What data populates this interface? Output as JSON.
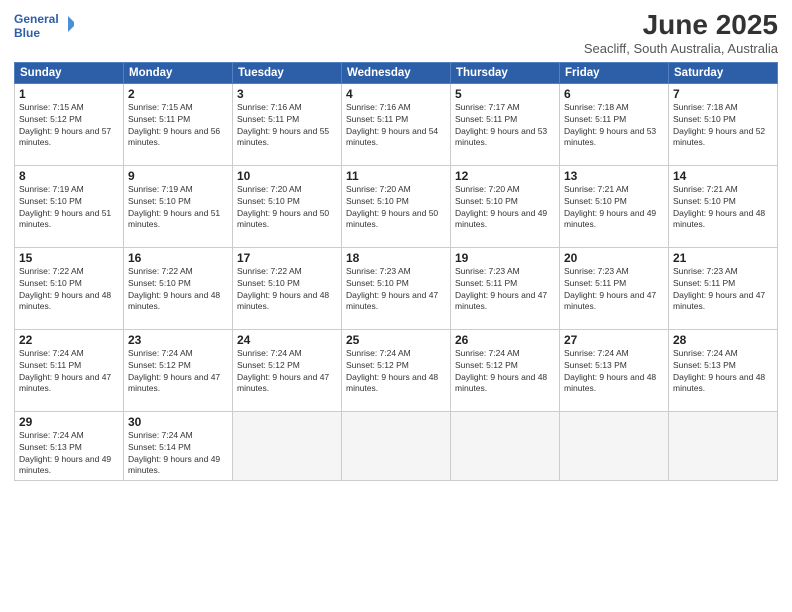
{
  "logo": {
    "line1": "General",
    "line2": "Blue"
  },
  "title": "June 2025",
  "subtitle": "Seacliff, South Australia, Australia",
  "weekdays": [
    "Sunday",
    "Monday",
    "Tuesday",
    "Wednesday",
    "Thursday",
    "Friday",
    "Saturday"
  ],
  "weeks": [
    [
      {
        "day": "1",
        "sunrise": "7:15 AM",
        "sunset": "5:12 PM",
        "daylight": "9 hours and 57 minutes."
      },
      {
        "day": "2",
        "sunrise": "7:15 AM",
        "sunset": "5:11 PM",
        "daylight": "9 hours and 56 minutes."
      },
      {
        "day": "3",
        "sunrise": "7:16 AM",
        "sunset": "5:11 PM",
        "daylight": "9 hours and 55 minutes."
      },
      {
        "day": "4",
        "sunrise": "7:16 AM",
        "sunset": "5:11 PM",
        "daylight": "9 hours and 54 minutes."
      },
      {
        "day": "5",
        "sunrise": "7:17 AM",
        "sunset": "5:11 PM",
        "daylight": "9 hours and 53 minutes."
      },
      {
        "day": "6",
        "sunrise": "7:18 AM",
        "sunset": "5:11 PM",
        "daylight": "9 hours and 53 minutes."
      },
      {
        "day": "7",
        "sunrise": "7:18 AM",
        "sunset": "5:10 PM",
        "daylight": "9 hours and 52 minutes."
      }
    ],
    [
      {
        "day": "8",
        "sunrise": "7:19 AM",
        "sunset": "5:10 PM",
        "daylight": "9 hours and 51 minutes."
      },
      {
        "day": "9",
        "sunrise": "7:19 AM",
        "sunset": "5:10 PM",
        "daylight": "9 hours and 51 minutes."
      },
      {
        "day": "10",
        "sunrise": "7:20 AM",
        "sunset": "5:10 PM",
        "daylight": "9 hours and 50 minutes."
      },
      {
        "day": "11",
        "sunrise": "7:20 AM",
        "sunset": "5:10 PM",
        "daylight": "9 hours and 50 minutes."
      },
      {
        "day": "12",
        "sunrise": "7:20 AM",
        "sunset": "5:10 PM",
        "daylight": "9 hours and 49 minutes."
      },
      {
        "day": "13",
        "sunrise": "7:21 AM",
        "sunset": "5:10 PM",
        "daylight": "9 hours and 49 minutes."
      },
      {
        "day": "14",
        "sunrise": "7:21 AM",
        "sunset": "5:10 PM",
        "daylight": "9 hours and 48 minutes."
      }
    ],
    [
      {
        "day": "15",
        "sunrise": "7:22 AM",
        "sunset": "5:10 PM",
        "daylight": "9 hours and 48 minutes."
      },
      {
        "day": "16",
        "sunrise": "7:22 AM",
        "sunset": "5:10 PM",
        "daylight": "9 hours and 48 minutes."
      },
      {
        "day": "17",
        "sunrise": "7:22 AM",
        "sunset": "5:10 PM",
        "daylight": "9 hours and 48 minutes."
      },
      {
        "day": "18",
        "sunrise": "7:23 AM",
        "sunset": "5:10 PM",
        "daylight": "9 hours and 47 minutes."
      },
      {
        "day": "19",
        "sunrise": "7:23 AM",
        "sunset": "5:11 PM",
        "daylight": "9 hours and 47 minutes."
      },
      {
        "day": "20",
        "sunrise": "7:23 AM",
        "sunset": "5:11 PM",
        "daylight": "9 hours and 47 minutes."
      },
      {
        "day": "21",
        "sunrise": "7:23 AM",
        "sunset": "5:11 PM",
        "daylight": "9 hours and 47 minutes."
      }
    ],
    [
      {
        "day": "22",
        "sunrise": "7:24 AM",
        "sunset": "5:11 PM",
        "daylight": "9 hours and 47 minutes."
      },
      {
        "day": "23",
        "sunrise": "7:24 AM",
        "sunset": "5:12 PM",
        "daylight": "9 hours and 47 minutes."
      },
      {
        "day": "24",
        "sunrise": "7:24 AM",
        "sunset": "5:12 PM",
        "daylight": "9 hours and 47 minutes."
      },
      {
        "day": "25",
        "sunrise": "7:24 AM",
        "sunset": "5:12 PM",
        "daylight": "9 hours and 48 minutes."
      },
      {
        "day": "26",
        "sunrise": "7:24 AM",
        "sunset": "5:12 PM",
        "daylight": "9 hours and 48 minutes."
      },
      {
        "day": "27",
        "sunrise": "7:24 AM",
        "sunset": "5:13 PM",
        "daylight": "9 hours and 48 minutes."
      },
      {
        "day": "28",
        "sunrise": "7:24 AM",
        "sunset": "5:13 PM",
        "daylight": "9 hours and 48 minutes."
      }
    ],
    [
      {
        "day": "29",
        "sunrise": "7:24 AM",
        "sunset": "5:13 PM",
        "daylight": "9 hours and 49 minutes."
      },
      {
        "day": "30",
        "sunrise": "7:24 AM",
        "sunset": "5:14 PM",
        "daylight": "9 hours and 49 minutes."
      },
      null,
      null,
      null,
      null,
      null
    ]
  ]
}
